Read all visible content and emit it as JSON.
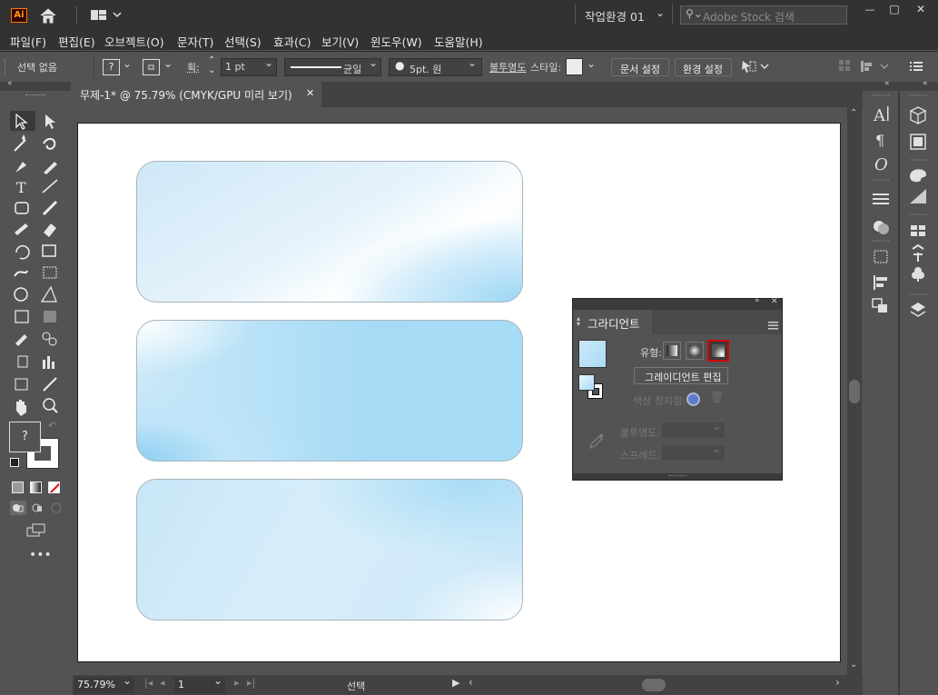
{
  "app": {
    "logo_text": "Ai",
    "workspace": "작업환경 01",
    "search_placeholder": "Adobe Stock 검색"
  },
  "window_controls": {
    "minimize": "—",
    "maximize": "□",
    "close": "✕"
  },
  "menu": [
    "파일(F)",
    "편집(E)",
    "오브젝트(O)",
    "문자(T)",
    "선택(S)",
    "효과(C)",
    "보기(V)",
    "윈도우(W)",
    "도움말(H)"
  ],
  "control_bar": {
    "selection_label": "선택 없음",
    "fill_value": "?",
    "stroke_label": "획:",
    "stroke_weight": "1 pt",
    "stroke_profile": "균일",
    "brush_size": "5pt. 원",
    "opacity_label": "불투명도",
    "style_label": "스타일:",
    "doc_setup_button": "문서 설정",
    "prefs_button": "환경 설정"
  },
  "document_tab": {
    "title": "무제-1* @ 75.79% (CMYK/GPU 미리 보기)",
    "close": "✕"
  },
  "status_bar": {
    "zoom": "75.79%",
    "page": "1",
    "mode": "선택"
  },
  "gradient_panel": {
    "title": "그라디언트",
    "type_label": "유형:",
    "edit_button": "그레이디언트 편집",
    "color_stop_label": "색상 정지점:",
    "opacity_label": "불투명도:",
    "spread_label": "스프레드:",
    "selected_type": "freeform"
  },
  "colors": {
    "accent": "#d40000",
    "gradient_light": "#e9f5fc",
    "gradient_dark": "#9bd7f5"
  },
  "tools": {
    "fill_question": "?"
  }
}
